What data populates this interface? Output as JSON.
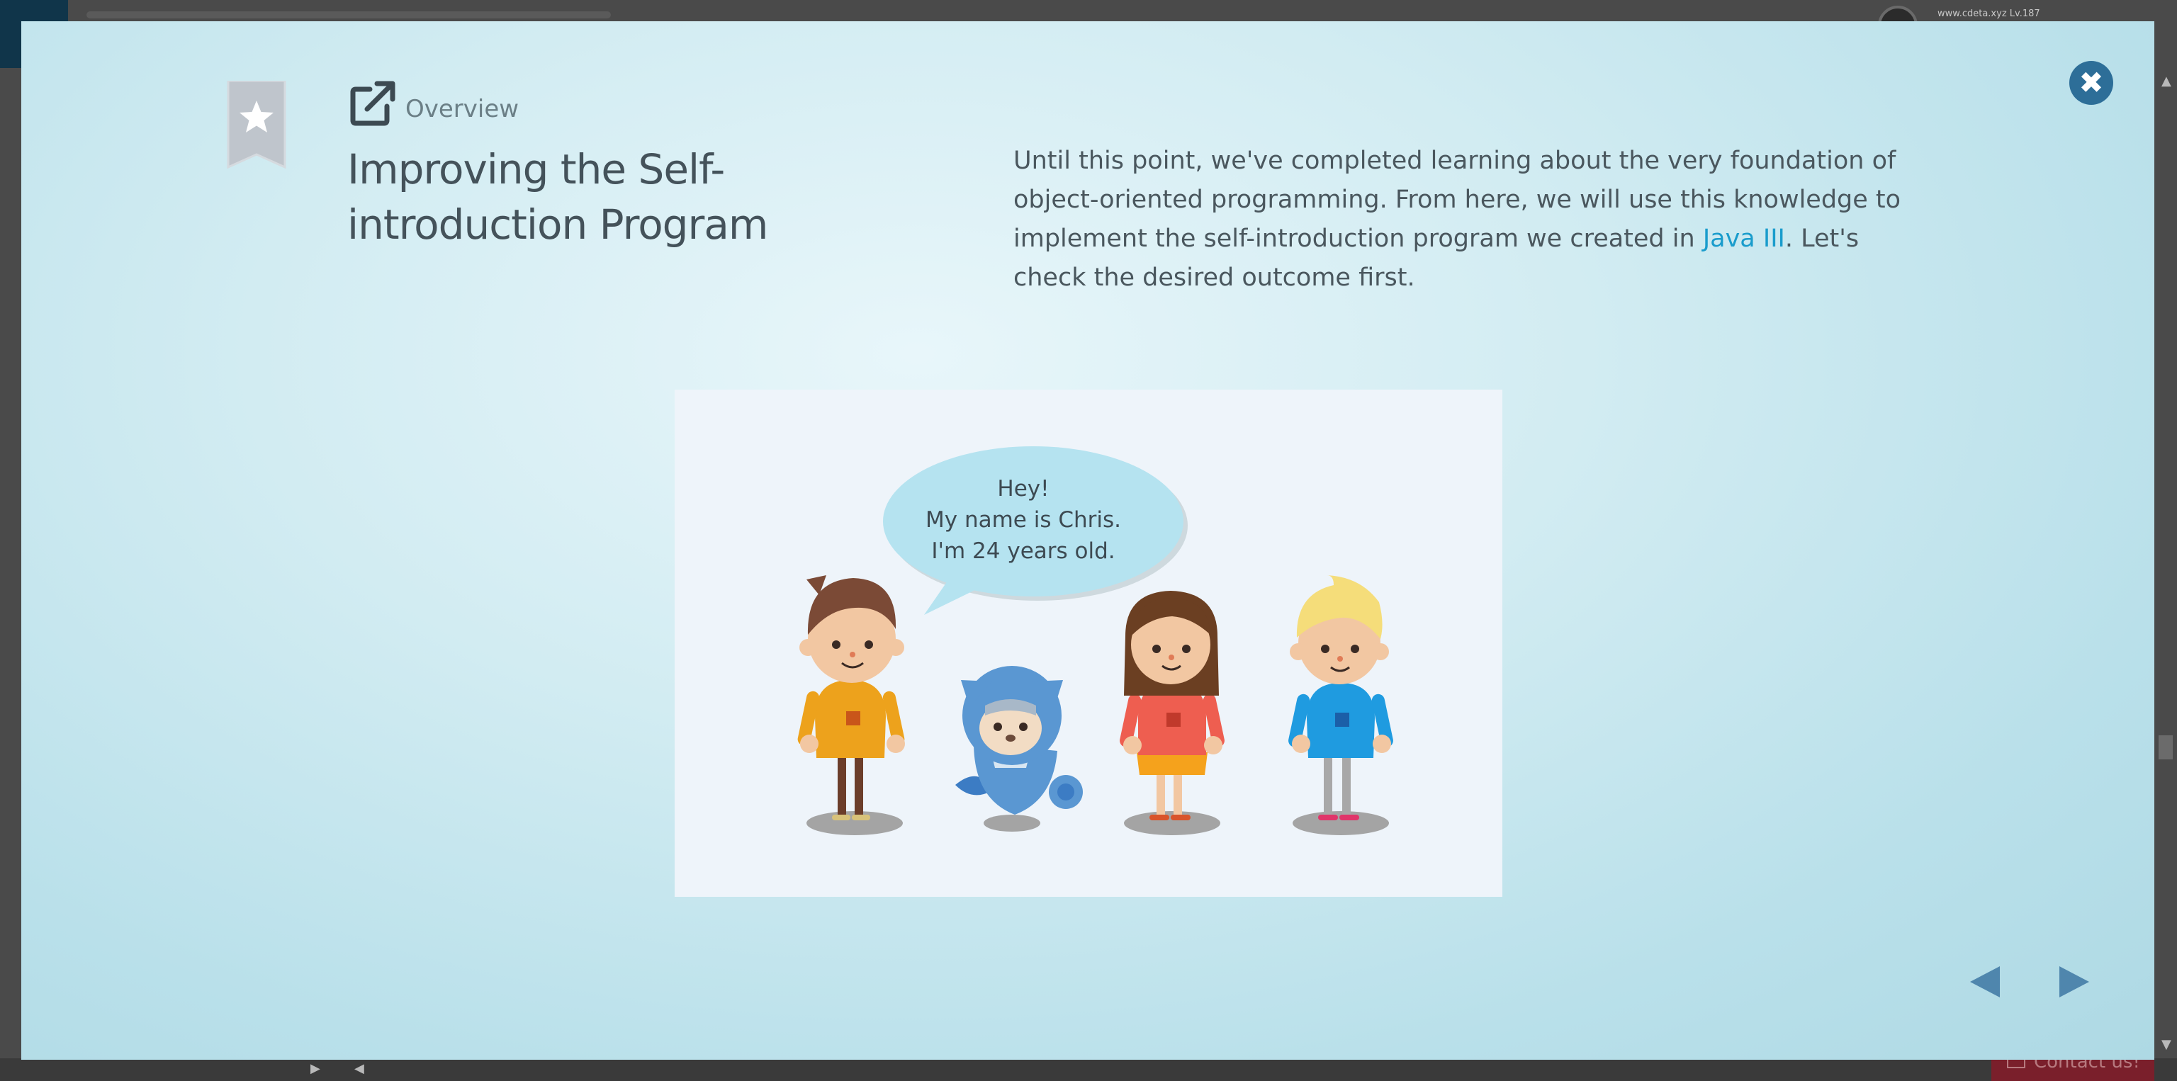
{
  "background": {
    "logo_text": "",
    "user_info": "www.cdeta.xyz Lv.187"
  },
  "modal": {
    "breadcrumb": "Overview",
    "title": "Improving the Self-introduction Program",
    "intro": {
      "before_link": "Until this point, we've completed learning about the very foundation of object-oriented programming. From here, we will use this knowledge to implement the self-introduction program we created in ",
      "link_text": "Java III",
      "after_link": ". Let's check the desired outcome first."
    },
    "speech": {
      "line1": "Hey!",
      "line2": "My name is Chris.",
      "line3": "I'm 24 years old."
    },
    "close_glyph": "✖"
  },
  "footer": {
    "contact_label": "Contact us!"
  },
  "icons": {
    "bookmark": "bookmark-star-icon",
    "open": "external-link-icon",
    "close": "close-icon",
    "prev": "triangle-left-icon",
    "next": "triangle-right-icon"
  },
  "colors": {
    "accent": "#2d6e98",
    "link": "#1a9ccc",
    "title": "#44525a",
    "nav": "#4f86ad"
  }
}
